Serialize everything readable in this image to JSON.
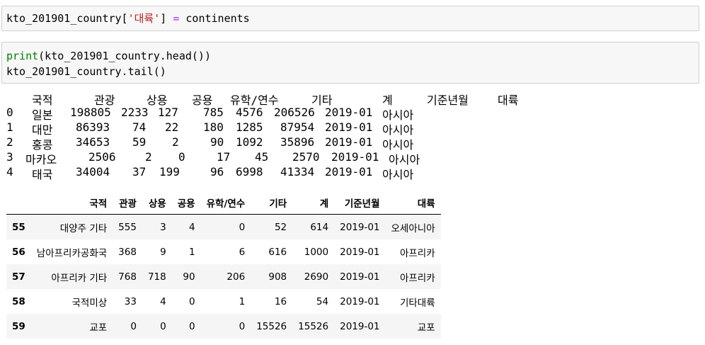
{
  "cells": {
    "cell1": {
      "line1": {
        "pre": "kto_201901_country[",
        "str": "'대륙'",
        "mid": "] ",
        "op": "=",
        "post": " continents"
      }
    },
    "cell2": {
      "line1": {
        "kw": "print",
        "rest": "(kto_201901_country.head())"
      },
      "line2": "kto_201901_country.tail()"
    }
  },
  "head_output": {
    "header": [
      "국적",
      "관광",
      "상용",
      "공용",
      "유학/연수",
      "기타",
      "계",
      "기준년월",
      "대륙"
    ],
    "rows": [
      {
        "idx": "0",
        "country": "일본",
        "tour": "198805",
        "biz": "2233",
        "off": "127",
        "study": "785",
        "stu2": "4576",
        "etc": "206526",
        "date": "2019-01",
        "cont": "아시아"
      },
      {
        "idx": "1",
        "country": "대만",
        "tour": "86393",
        "biz": "74",
        "off": "22",
        "study": "180",
        "stu2": "1285",
        "etc": "87954",
        "date": "2019-01",
        "cont": "아시아"
      },
      {
        "idx": "2",
        "country": "홍콩",
        "tour": "34653",
        "biz": "59",
        "off": "2",
        "study": "90",
        "stu2": "1092",
        "etc": "35896",
        "date": "2019-01",
        "cont": "아시아"
      },
      {
        "idx": "3",
        "country": "마카오",
        "tour": "2506",
        "biz": "2",
        "off": "0",
        "study": "17",
        "stu2": "45",
        "etc": "2570",
        "date": "2019-01",
        "cont": "아시아"
      },
      {
        "idx": "4",
        "country": "태국",
        "tour": "34004",
        "biz": "37",
        "off": "199",
        "study": "96",
        "stu2": "6998",
        "etc": "41334",
        "date": "2019-01",
        "cont": "아시아"
      }
    ]
  },
  "tail_table": {
    "columns": [
      "",
      "국적",
      "관광",
      "상용",
      "공용",
      "유학/연수",
      "기타",
      "계",
      "기준년월",
      "대륙"
    ],
    "rows": [
      {
        "idx": "55",
        "cells": [
          "대양주 기타",
          "555",
          "3",
          "4",
          "0",
          "52",
          "614",
          "2019-01",
          "오세아니아"
        ]
      },
      {
        "idx": "56",
        "cells": [
          "남아프리카공화국",
          "368",
          "9",
          "1",
          "6",
          "616",
          "1000",
          "2019-01",
          "아프리카"
        ]
      },
      {
        "idx": "57",
        "cells": [
          "아프리카 기타",
          "768",
          "718",
          "90",
          "206",
          "908",
          "2690",
          "2019-01",
          "아프리카"
        ]
      },
      {
        "idx": "58",
        "cells": [
          "국적미상",
          "33",
          "4",
          "0",
          "1",
          "16",
          "54",
          "2019-01",
          "기타대륙"
        ]
      },
      {
        "idx": "59",
        "cells": [
          "교포",
          "0",
          "0",
          "0",
          "0",
          "15526",
          "15526",
          "2019-01",
          "교포"
        ]
      }
    ]
  }
}
